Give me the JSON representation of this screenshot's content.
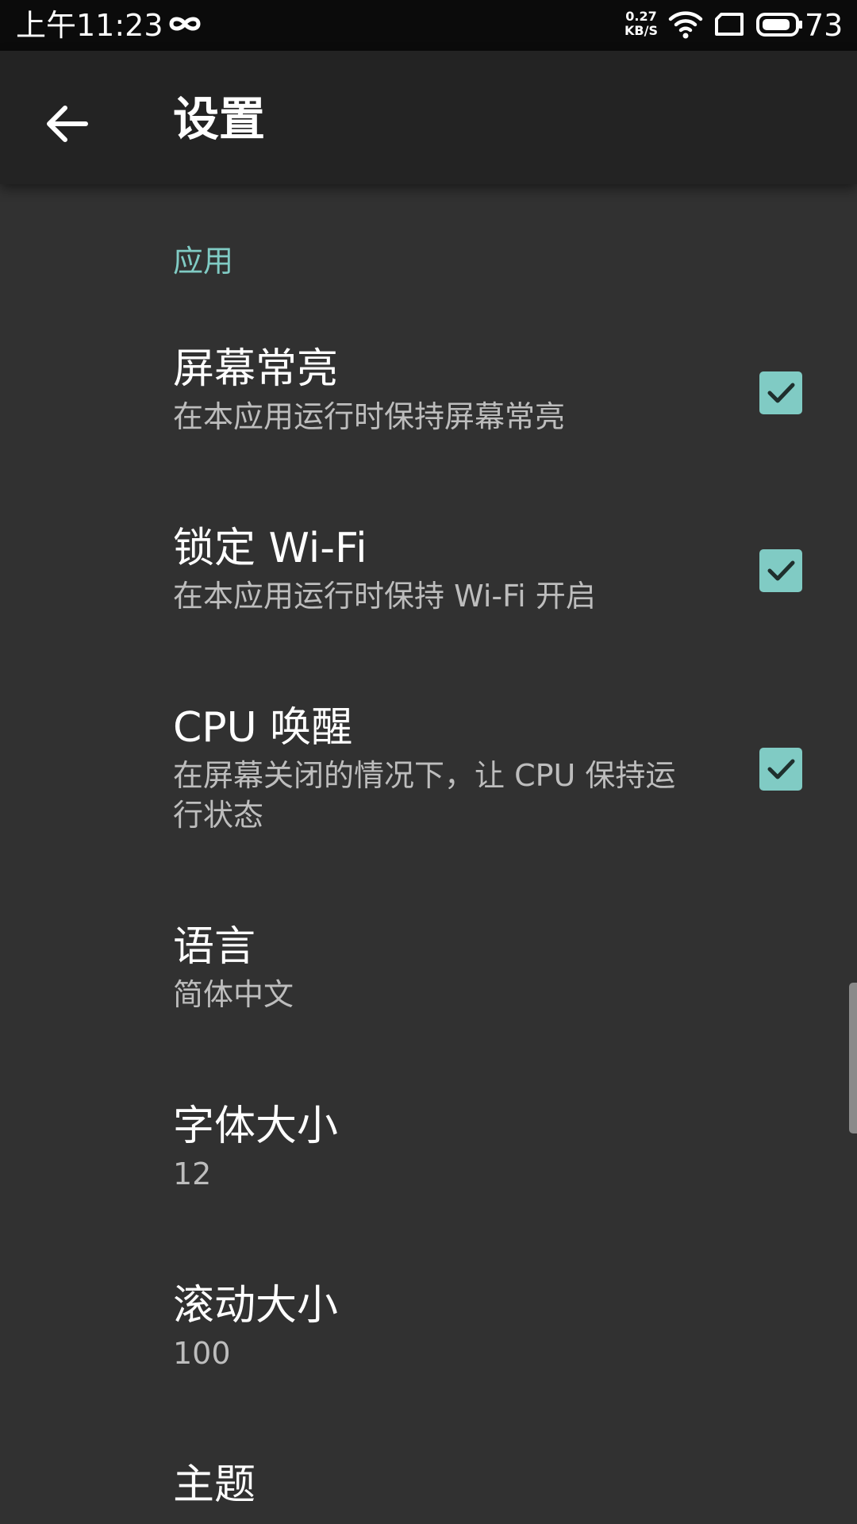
{
  "status_bar": {
    "time": "上午11:23",
    "link_icon": "infinity-icon",
    "net_rate_value": "0.27",
    "net_rate_unit": "KB/S",
    "wifi_icon": "wifi-icon",
    "screen_icon": "screen-icon",
    "battery_icon": "battery-icon",
    "battery_level": "73"
  },
  "app_bar": {
    "back_icon": "arrow-back-icon",
    "title": "设置"
  },
  "section": {
    "title": "应用"
  },
  "preferences": [
    {
      "title": "屏幕常亮",
      "summary": "在本应用运行时保持屏幕常亮",
      "checked": true
    },
    {
      "title": "锁定 Wi-Fi",
      "summary": "在本应用运行时保持 Wi-Fi 开启",
      "checked": true
    },
    {
      "title": "CPU 唤醒",
      "summary": "在屏幕关闭的情况下，让 CPU 保持运行状态",
      "checked": true
    },
    {
      "title": "语言",
      "summary": "简体中文"
    },
    {
      "title": "字体大小",
      "summary": "12"
    },
    {
      "title": "滚动大小",
      "summary": "100"
    },
    {
      "title": "主题"
    }
  ],
  "colors": {
    "accent": "#80cbc4",
    "background": "#313131",
    "app_bar": "#232323",
    "status_bar": "#0b0b0b"
  }
}
